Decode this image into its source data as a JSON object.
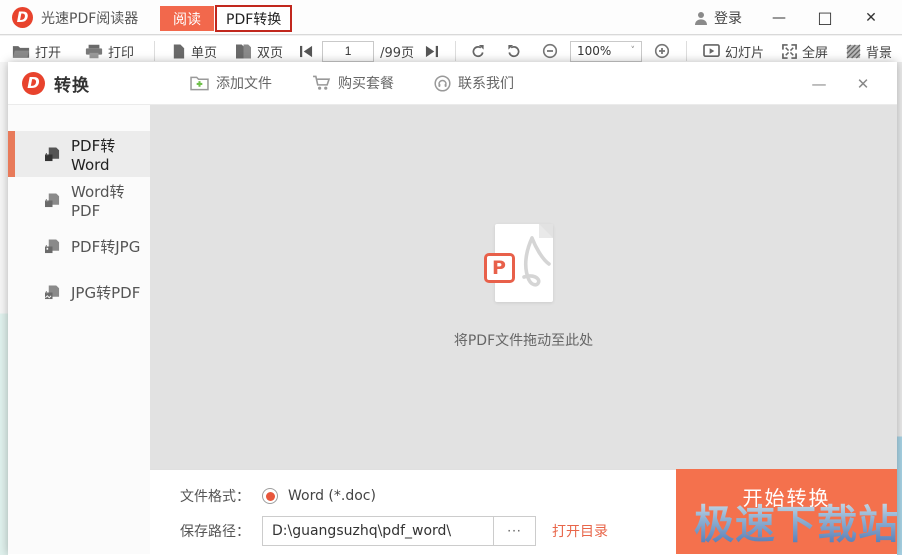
{
  "window": {
    "title": "光速PDF阅读器",
    "tabs": {
      "read": "阅读",
      "convert": "PDF转换"
    },
    "login_label": "登录",
    "controls": {
      "minimize": "—",
      "maximize": "□",
      "close": "✕"
    }
  },
  "toolbar": {
    "open": "打开",
    "print": "打印",
    "single_page": "单页",
    "double_page": "双页",
    "page_value": "1",
    "page_total": "/99页",
    "zoom_value": "100%",
    "slideshow": "幻灯片",
    "fullscreen": "全屏",
    "background": "背景"
  },
  "dialog": {
    "title": "转换",
    "nav": {
      "add_file": "添加文件",
      "buy_plan": "购买套餐",
      "contact_us": "联系我们"
    },
    "controls": {
      "minimize": "—",
      "close": "✕"
    },
    "sidebar": {
      "items": [
        {
          "label": "PDF转Word",
          "selected": true
        },
        {
          "label": "Word转PDF",
          "selected": false
        },
        {
          "label": "PDF转JPG",
          "selected": false
        },
        {
          "label": "JPG转PDF",
          "selected": false
        }
      ]
    },
    "dropzone": {
      "hint": "将PDF文件拖动至此处",
      "badge_letter": "P"
    },
    "form": {
      "format_label": "文件格式：",
      "format_option": "Word (*.doc)",
      "path_label": "保存路径：",
      "path_value": "D:\\guangsuzhq\\pdf_word\\",
      "browse_label": "···",
      "open_dir_label": "打开目录"
    },
    "start_button": "开始转换"
  },
  "watermark": "极速下载站",
  "colors": {
    "brand_red": "#e8432d",
    "tab_orange": "#f2684c",
    "tab_border_red": "#c1271d",
    "accent_orange": "#e87a5a",
    "start_button_orange": "#f4714d",
    "link_red": "#e8664a",
    "dropzone_gray": "#e2e2e2"
  }
}
